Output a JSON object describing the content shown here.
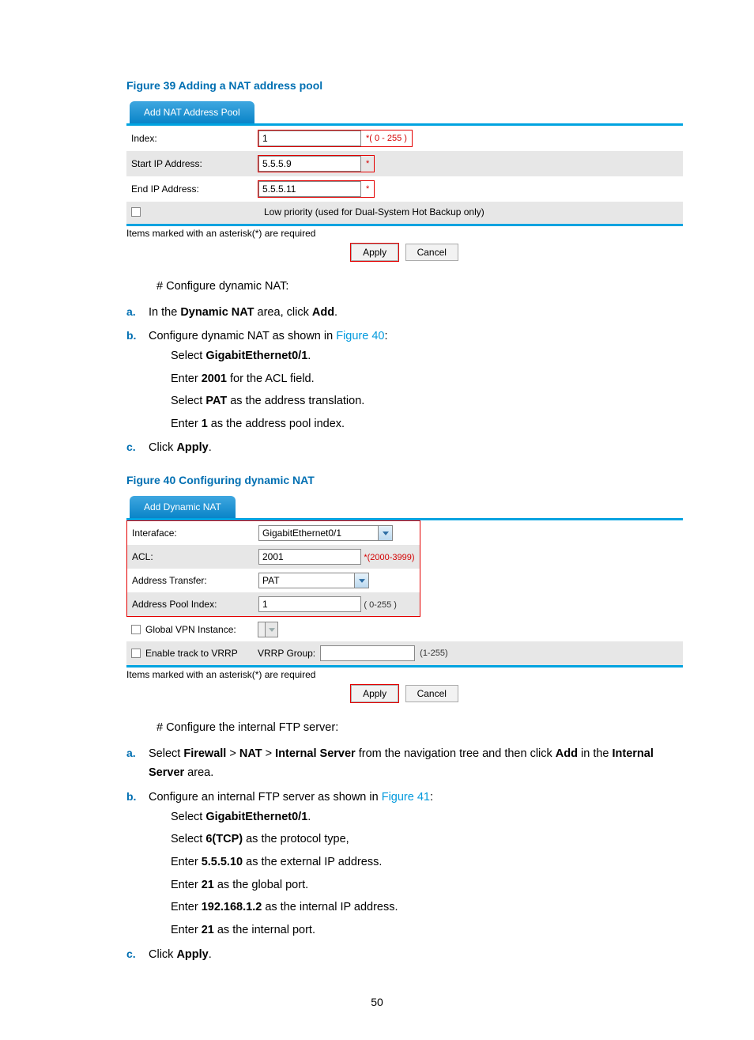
{
  "page_number": "50",
  "figure39": {
    "title": "Figure 39 Adding a NAT address pool",
    "tab": "Add NAT Address Pool",
    "rows": {
      "index": {
        "label": "Index:",
        "value": "1",
        "hint": "*( 0 - 255 )"
      },
      "start": {
        "label": "Start IP Address:",
        "value": "5.5.5.9",
        "star": "*"
      },
      "end": {
        "label": "End IP Address:",
        "value": "5.5.5.11",
        "star": "*"
      },
      "lowprio": "Low priority (used for Dual-System Hot Backup only)"
    },
    "note": "Items marked with an asterisk(*) are required",
    "apply": "Apply",
    "cancel": "Cancel"
  },
  "section1": {
    "heading": "# Configure dynamic NAT:",
    "a_pre": "In the ",
    "a_bold": "Dynamic NAT",
    "a_post": " area, click ",
    "a_bold2": "Add",
    "a_end": ".",
    "b_pre": "Configure dynamic NAT as shown in ",
    "b_link": "Figure 40",
    "b_end": ":",
    "sub1_pre": "Select ",
    "sub1_bold": "GigabitEthernet0/1",
    "sub1_end": ".",
    "sub2_pre": "Enter ",
    "sub2_bold": "2001",
    "sub2_post": " for the ACL field.",
    "sub3_pre": "Select ",
    "sub3_bold": "PAT",
    "sub3_post": " as the address translation.",
    "sub4_pre": "Enter ",
    "sub4_bold": "1",
    "sub4_post": " as the address pool index.",
    "c_pre": "Click ",
    "c_bold": "Apply",
    "c_end": "."
  },
  "figure40": {
    "title": "Figure 40 Configuring dynamic NAT",
    "tab": "Add Dynamic NAT",
    "rows": {
      "iface": {
        "label": "Interaface:",
        "value": "GigabitEthernet0/1"
      },
      "acl": {
        "label": "ACL:",
        "value": "2001",
        "hint": "*(2000-3999)"
      },
      "transfer": {
        "label": "Address Transfer:",
        "value": "PAT"
      },
      "pool": {
        "label": "Address Pool Index:",
        "value": "1",
        "hint": "( 0-255 )"
      },
      "vpn": {
        "label": "Global VPN Instance:"
      },
      "vrrp": {
        "label": "Enable track to VRRP",
        "group_label": "VRRP Group:",
        "range": "(1-255)"
      }
    },
    "note": "Items marked with an asterisk(*) are required",
    "apply": "Apply",
    "cancel": "Cancel"
  },
  "section2": {
    "heading": "# Configure the internal FTP server:",
    "a_pre": "Select ",
    "a_b1": "Firewall",
    "a_gt1": " > ",
    "a_b2": "NAT",
    "a_gt2": " > ",
    "a_b3": "Internal Server",
    "a_mid": " from the navigation tree and then click ",
    "a_b4": "Add",
    "a_post": " in the ",
    "a_b5": "Internal Server",
    "a_end": " area.",
    "b_pre": "Configure an internal FTP server as shown in ",
    "b_link": "Figure 41",
    "b_end": ":",
    "sub1_pre": "Select ",
    "sub1_bold": "GigabitEthernet0/1",
    "sub1_end": ".",
    "sub2_pre": "Select ",
    "sub2_bold": "6(TCP)",
    "sub2_post": " as the protocol type,",
    "sub3_pre": "Enter ",
    "sub3_bold": "5.5.5.10",
    "sub3_post": " as the external IP address.",
    "sub4_pre": "Enter ",
    "sub4_bold": "21",
    "sub4_post": " as the global port.",
    "sub5_pre": "Enter ",
    "sub5_bold": "192.168.1.2",
    "sub5_post": " as the internal IP address.",
    "sub6_pre": "Enter ",
    "sub6_bold": "21",
    "sub6_post": " as the internal port.",
    "c_pre": "Click ",
    "c_bold": "Apply",
    "c_end": "."
  }
}
